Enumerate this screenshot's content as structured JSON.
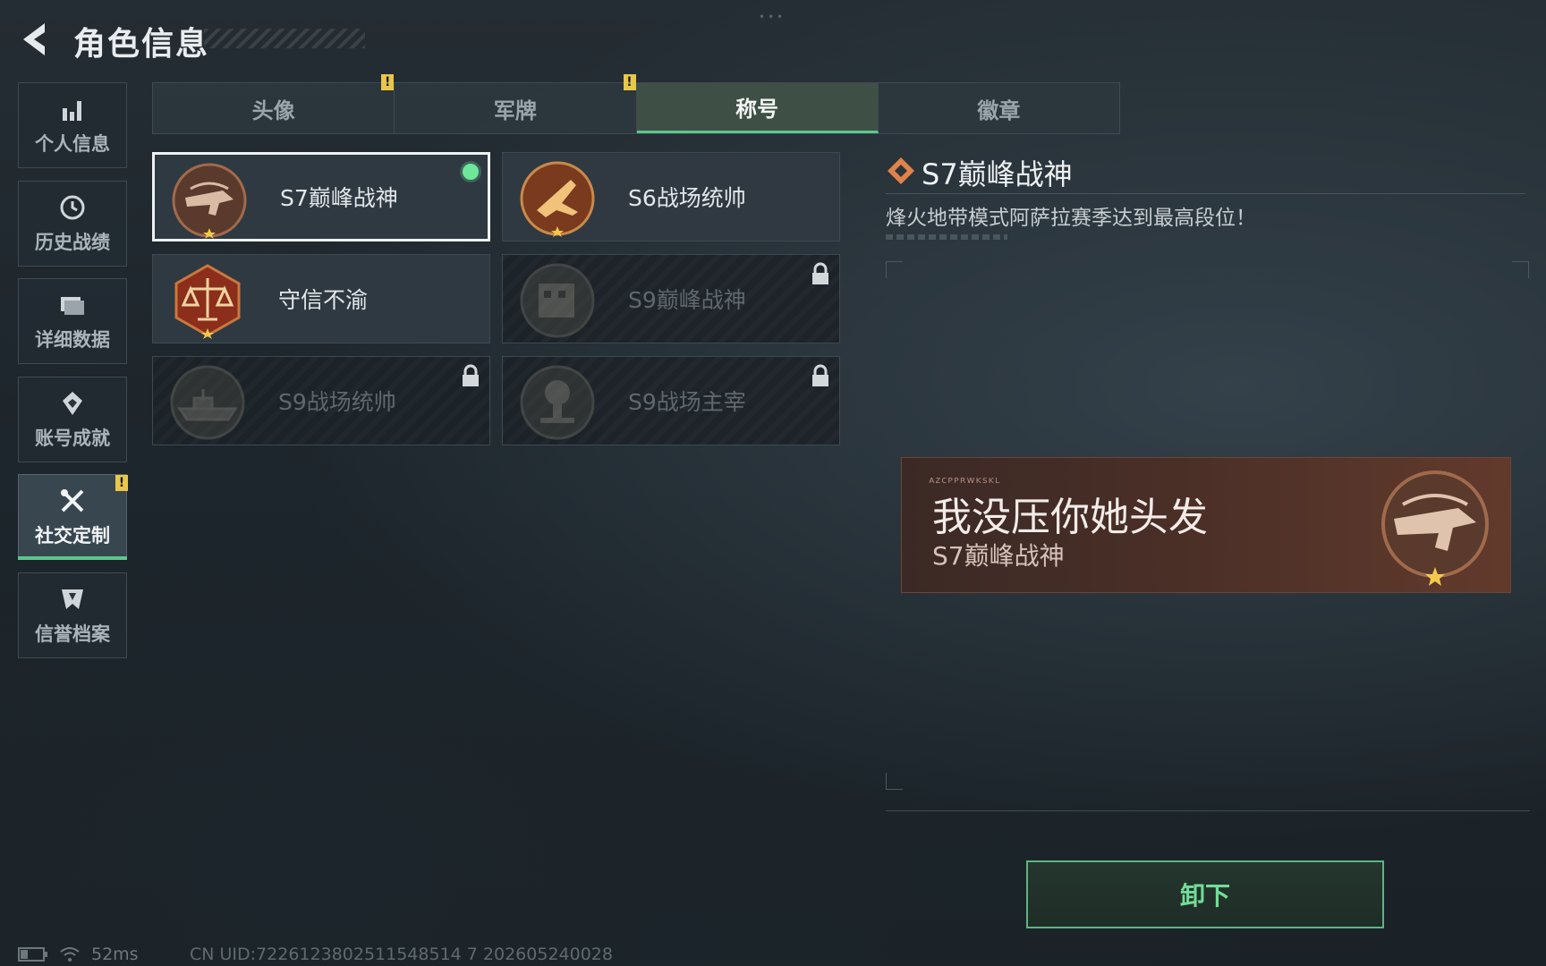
{
  "header": {
    "title": "角色信息"
  },
  "sidebar": {
    "items": [
      {
        "label": "个人信息",
        "icon": "bar-chart-icon"
      },
      {
        "label": "历史战绩",
        "icon": "history-clock-icon"
      },
      {
        "label": "详细数据",
        "icon": "folder-icon"
      },
      {
        "label": "账号成就",
        "icon": "achievement-icon"
      },
      {
        "label": "社交定制",
        "icon": "tools-icon",
        "active": true
      },
      {
        "label": "信誉档案",
        "icon": "shield-icon"
      }
    ]
  },
  "tabs": [
    {
      "label": "头像"
    },
    {
      "label": "军牌"
    },
    {
      "label": "称号",
      "active": true
    },
    {
      "label": "徽章"
    }
  ],
  "badges": {
    "warning": "!"
  },
  "titles": [
    {
      "name": "S7巅峰战神",
      "state": "equipped",
      "medal": "crossbow-medal-icon"
    },
    {
      "name": "S6战场统帅",
      "state": "unlocked",
      "medal": "jet-medal-icon"
    },
    {
      "name": "守信不渝",
      "state": "unlocked",
      "medal": "scales-medal-icon"
    },
    {
      "name": "S9巅峰战神",
      "state": "locked",
      "medal": "building-medal-icon"
    },
    {
      "name": "S9战场统帅",
      "state": "locked",
      "medal": "warship-medal-icon"
    },
    {
      "name": "S9战场主宰",
      "state": "locked",
      "medal": "mushroom-cloud-medal-icon"
    }
  ],
  "detail": {
    "title": "S7巅峰战神",
    "description": "烽火地带模式阿萨拉赛季达到最高段位！"
  },
  "preview": {
    "small_text": "ᴀᴢᴄᴘᴘʀᴡᴋsᴋʟ",
    "nickname": "我没压你她头发",
    "title": "S7巅峰战神"
  },
  "actions": {
    "unequip_label": "卸下"
  },
  "status": {
    "ping": "52ms",
    "uid": "CN UID:7226123802511548514 7 202605240028"
  },
  "colors": {
    "accent": "#5cc88a",
    "warning": "#e8c74a",
    "banner": "#4a2f27"
  }
}
